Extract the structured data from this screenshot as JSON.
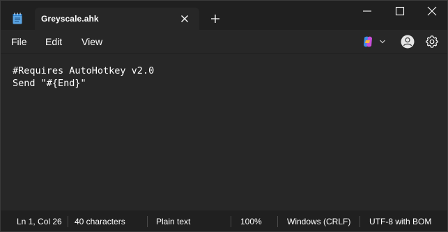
{
  "tab": {
    "title": "Greyscale.ahk",
    "close_icon": "close-icon",
    "new_tab_icon": "plus-icon"
  },
  "window_controls": {
    "minimize_icon": "minimize-icon",
    "maximize_icon": "maximize-icon",
    "close_icon": "close-icon"
  },
  "menu": {
    "file": "File",
    "edit": "Edit",
    "view": "View"
  },
  "toolbar": {
    "copilot_icon": "copilot-icon",
    "copilot_dropdown_icon": "chevron-down-icon",
    "account_icon": "account-icon",
    "settings_icon": "gear-icon"
  },
  "editor": {
    "lines": [
      "#Requires AutoHotkey v2.0",
      "Send \"#{End}\""
    ]
  },
  "status": {
    "position": "Ln 1, Col 26",
    "characters": "40 characters",
    "format": "Plain text",
    "zoom": "100%",
    "line_ending": "Windows (CRLF)",
    "encoding": "UTF-8 with BOM"
  },
  "colors": {
    "titlebar_bg": "#202020",
    "content_bg": "#272727",
    "text": "#ffffff",
    "app_icon": "#4f9ddf"
  }
}
